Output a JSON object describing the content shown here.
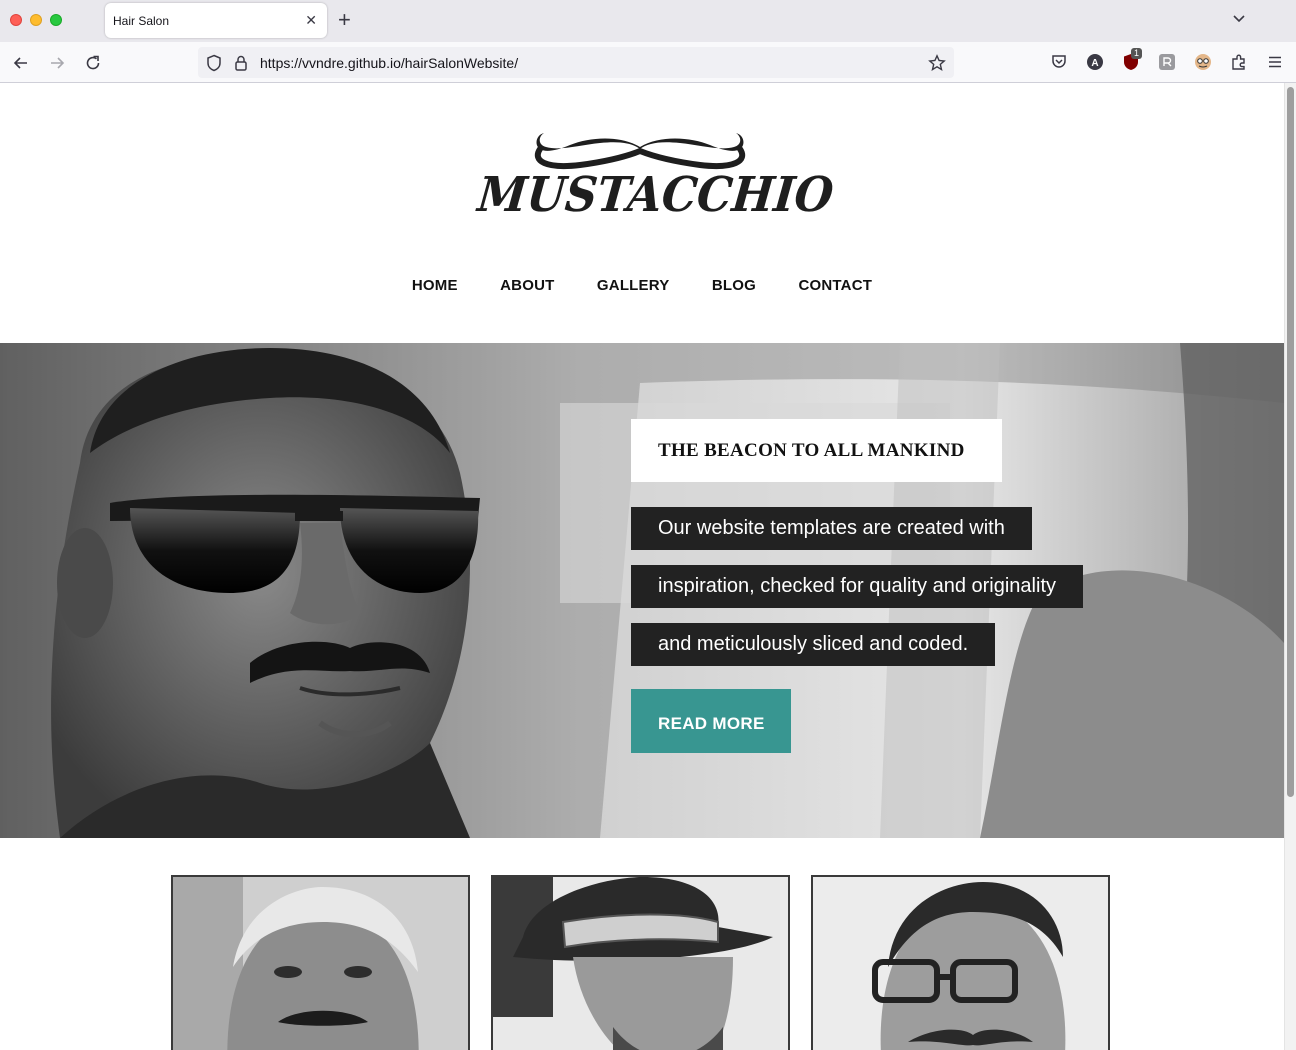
{
  "browser": {
    "tab_title": "Hair Salon",
    "url": "https://vvndre.github.io/hairSalonWebsite/",
    "extension_badge": "1"
  },
  "site": {
    "logo_text": "MUSTACCHIO",
    "menu": [
      "HOME",
      "ABOUT",
      "GALLERY",
      "BLOG",
      "CONTACT"
    ]
  },
  "hero": {
    "heading": "THE BEACON TO ALL MANKIND",
    "lines": [
      "Our website templates are created with",
      "inspiration, checked for quality and originality",
      "and meticulously sliced and coded."
    ],
    "button_label": "READ MORE"
  },
  "colors": {
    "accent_button": "#389691",
    "dark_text_box": "#222222"
  }
}
